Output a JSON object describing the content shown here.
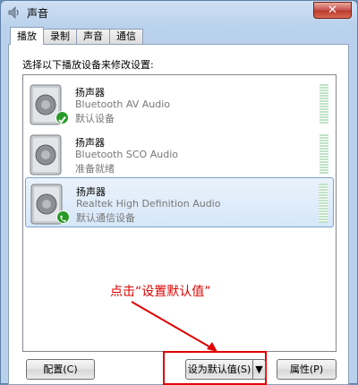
{
  "window": {
    "title": "声音",
    "close_label": "✕",
    "tabs": [
      {
        "label": "播放",
        "active": true
      },
      {
        "label": "录制",
        "active": false
      },
      {
        "label": "声音",
        "active": false
      },
      {
        "label": "通信",
        "active": false
      }
    ]
  },
  "playback": {
    "instruction": "选择以下播放设备来修改设置:",
    "devices": [
      {
        "name": "扬声器",
        "driver": "Bluetooth AV Audio",
        "state": "默认设备",
        "status_icon": "check-icon"
      },
      {
        "name": "扬声器",
        "driver": "Bluetooth SCO Audio",
        "state": "准备就绪",
        "status_icon": ""
      },
      {
        "name": "扬声器",
        "driver": "Realtek High Definition Audio",
        "state": "默认通信设备",
        "status_icon": "phone-icon",
        "selected": true
      }
    ]
  },
  "annotation": {
    "text": "点击“设置默认值”",
    "color": "#e00000"
  },
  "buttons": {
    "configure": "配置(C)",
    "set_default": "设为默认值(S)",
    "dropdown": "▼",
    "properties": "属性(P)"
  }
}
